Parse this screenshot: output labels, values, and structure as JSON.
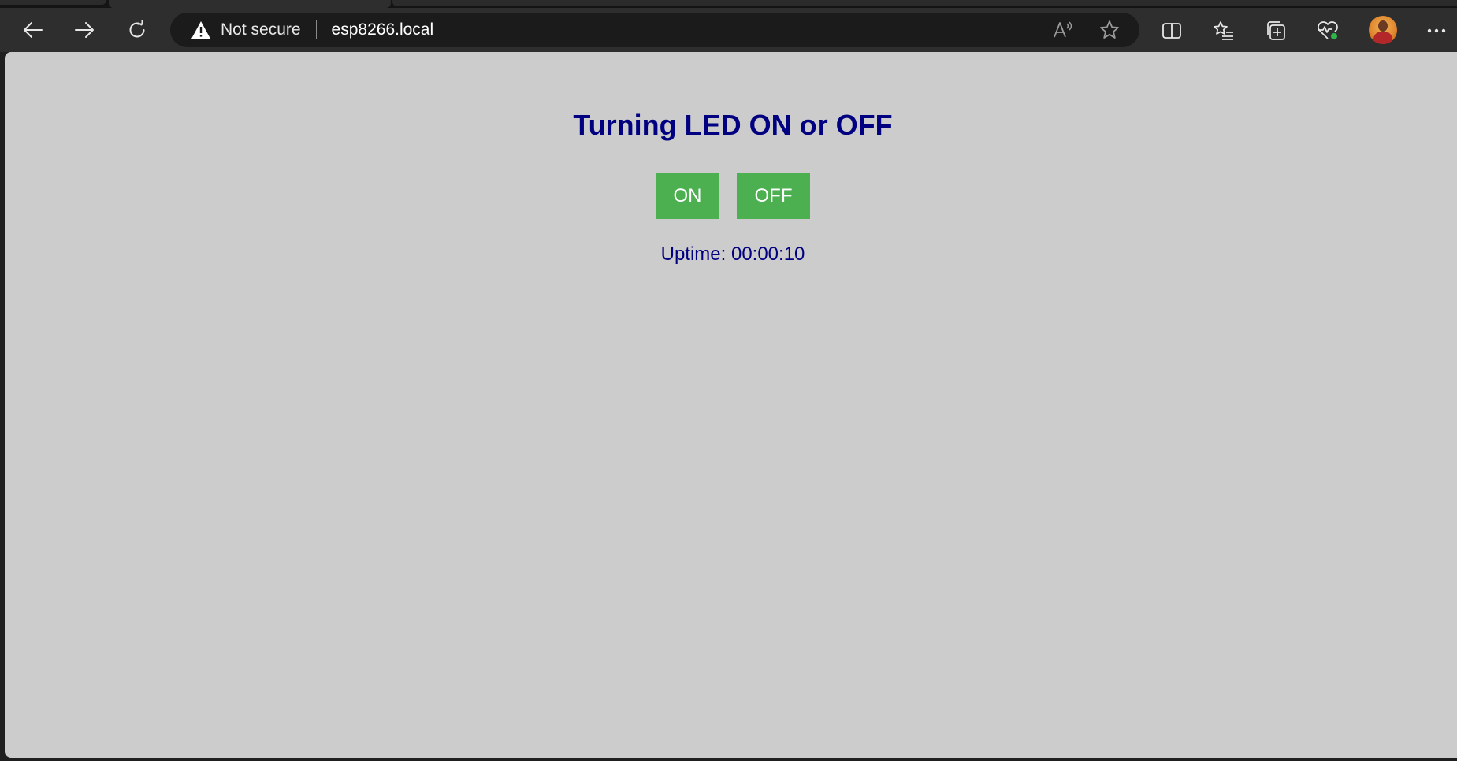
{
  "browser": {
    "security_label": "Not secure",
    "url": "esp8266.local",
    "icons": {
      "back": "back-arrow-icon",
      "forward": "forward-arrow-icon",
      "refresh": "refresh-icon",
      "warning": "warning-icon",
      "read_aloud": "read-aloud-icon",
      "favorite": "star-icon",
      "split_screen": "split-screen-icon",
      "favorites": "favorites-list-icon",
      "collections": "collections-icon",
      "performance": "heartbeat-icon",
      "profile": "profile-avatar",
      "menu": "more-dots-icon"
    }
  },
  "page": {
    "title": "Turning LED ON or OFF",
    "buttons": {
      "on_label": "ON",
      "off_label": "OFF"
    },
    "uptime": "Uptime: 00:00:10",
    "colors": {
      "background": "#cccccc",
      "text": "#000080",
      "button": "#4caf50",
      "button_text": "#ffffff"
    }
  }
}
